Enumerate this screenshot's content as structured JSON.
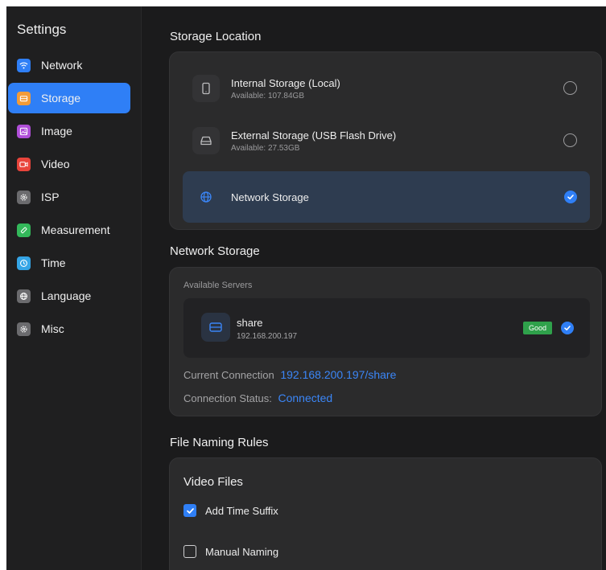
{
  "sidebar": {
    "title": "Settings",
    "items": [
      {
        "label": "Network",
        "icon": "wifi-icon",
        "color": "#2f7ff6"
      },
      {
        "label": "Storage",
        "icon": "storage-icon",
        "color": "#f29b38",
        "active": true
      },
      {
        "label": "Image",
        "icon": "image-icon",
        "color": "#b04ed8"
      },
      {
        "label": "Video",
        "icon": "video-icon",
        "color": "#e8443b"
      },
      {
        "label": "ISP",
        "icon": "isp-icon",
        "color": "#6b6b6e"
      },
      {
        "label": "Measurement",
        "icon": "measurement-icon",
        "color": "#33b85a"
      },
      {
        "label": "Time",
        "icon": "clock-icon",
        "color": "#35a5e6"
      },
      {
        "label": "Language",
        "icon": "globe-icon",
        "color": "#6b6b6e"
      },
      {
        "label": "Misc",
        "icon": "misc-icon",
        "color": "#6b6b6e"
      }
    ]
  },
  "storage_location": {
    "title": "Storage Location",
    "options": [
      {
        "name": "Internal Storage (Local)",
        "available": "Available: 107.84GB",
        "icon": "phone-icon",
        "selected": false
      },
      {
        "name": "External Storage (USB Flash Drive)",
        "available": "Available: 27.53GB",
        "icon": "hard-drive-icon",
        "selected": false
      },
      {
        "name": "Network Storage",
        "available": "",
        "icon": "globe-icon",
        "selected": true
      }
    ]
  },
  "network_storage": {
    "title": "Network Storage",
    "available_servers_label": "Available Servers",
    "server": {
      "name": "share",
      "ip": "192.168.200.197",
      "status_badge": "Good",
      "icon": "server-icon"
    },
    "current_connection_label": "Current Connection",
    "current_connection_value": "192.168.200.197/share",
    "connection_status_label": "Connection Status:",
    "connection_status_value": "Connected"
  },
  "file_naming": {
    "title": "File Naming Rules",
    "video_files_title": "Video Files",
    "options": [
      {
        "label": "Add Time Suffix",
        "checked": true
      },
      {
        "label": "Manual Naming",
        "checked": false
      }
    ]
  },
  "colors": {
    "accent": "#2f7ff6",
    "good": "#2fa14b",
    "background": "#1b1b1c",
    "card": "#2b2b2c"
  }
}
